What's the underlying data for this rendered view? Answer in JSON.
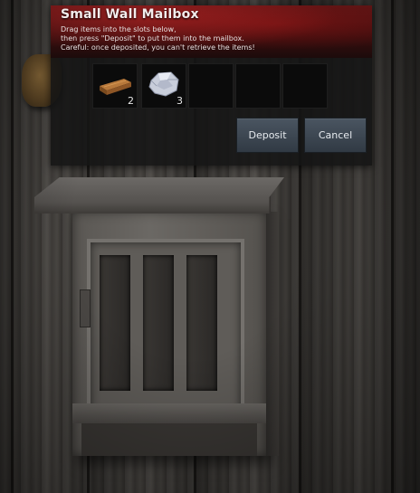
{
  "dialog": {
    "title": "Small Wall Mailbox",
    "description_lines": [
      "Drag items into the slots below,",
      "then press \"Deposit\" to put them into the mailbox.",
      "Careful: once deposited, you can't retrieve the items!"
    ],
    "slots": [
      {
        "item": "wood-plank-icon",
        "count": "2"
      },
      {
        "item": "stone-ore-icon",
        "count": "3"
      },
      {
        "item": null,
        "count": ""
      },
      {
        "item": null,
        "count": ""
      },
      {
        "item": null,
        "count": ""
      }
    ],
    "deposit_label": "Deposit",
    "cancel_label": "Cancel"
  },
  "colors": {
    "header_red": "#5a1414",
    "panel_bg": "#141414",
    "button_bg": "#3e4853",
    "text": "#f2ecec"
  }
}
